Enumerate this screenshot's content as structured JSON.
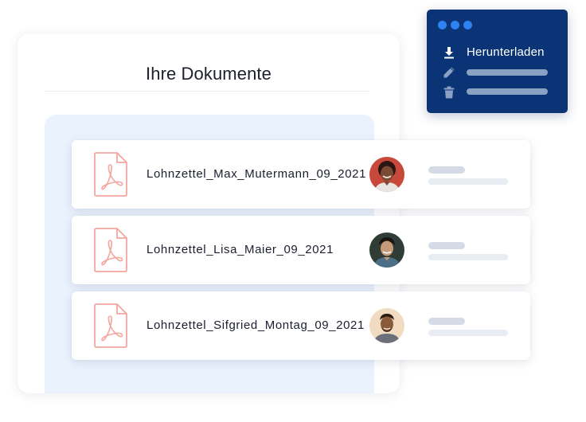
{
  "documents_card": {
    "title": "Ihre Dokumente"
  },
  "documents": [
    {
      "file_name": "Lohnzettel_Max_Mutermann_09_2021",
      "file_icon": "pdf-file-icon",
      "avatar": "person-avatar"
    },
    {
      "file_name": "Lohnzettel_Lisa_Maier_09_2021",
      "file_icon": "pdf-file-icon",
      "avatar": "person-avatar"
    },
    {
      "file_name": "Lohnzettel_Sifgried_Montag_09_2021",
      "file_icon": "pdf-file-icon",
      "avatar": "person-avatar"
    }
  ],
  "context_menu": {
    "items": [
      {
        "icon": "download-icon",
        "label": "Herunterladen"
      },
      {
        "icon": "pencil-icon",
        "label": ""
      },
      {
        "icon": "trash-icon",
        "label": ""
      }
    ]
  },
  "colors": {
    "menu_background": "#0a3475",
    "window_dot": "#2f80f0",
    "pdf_icon": "#f4a5a0",
    "panel_background": "#eaf2fd"
  }
}
